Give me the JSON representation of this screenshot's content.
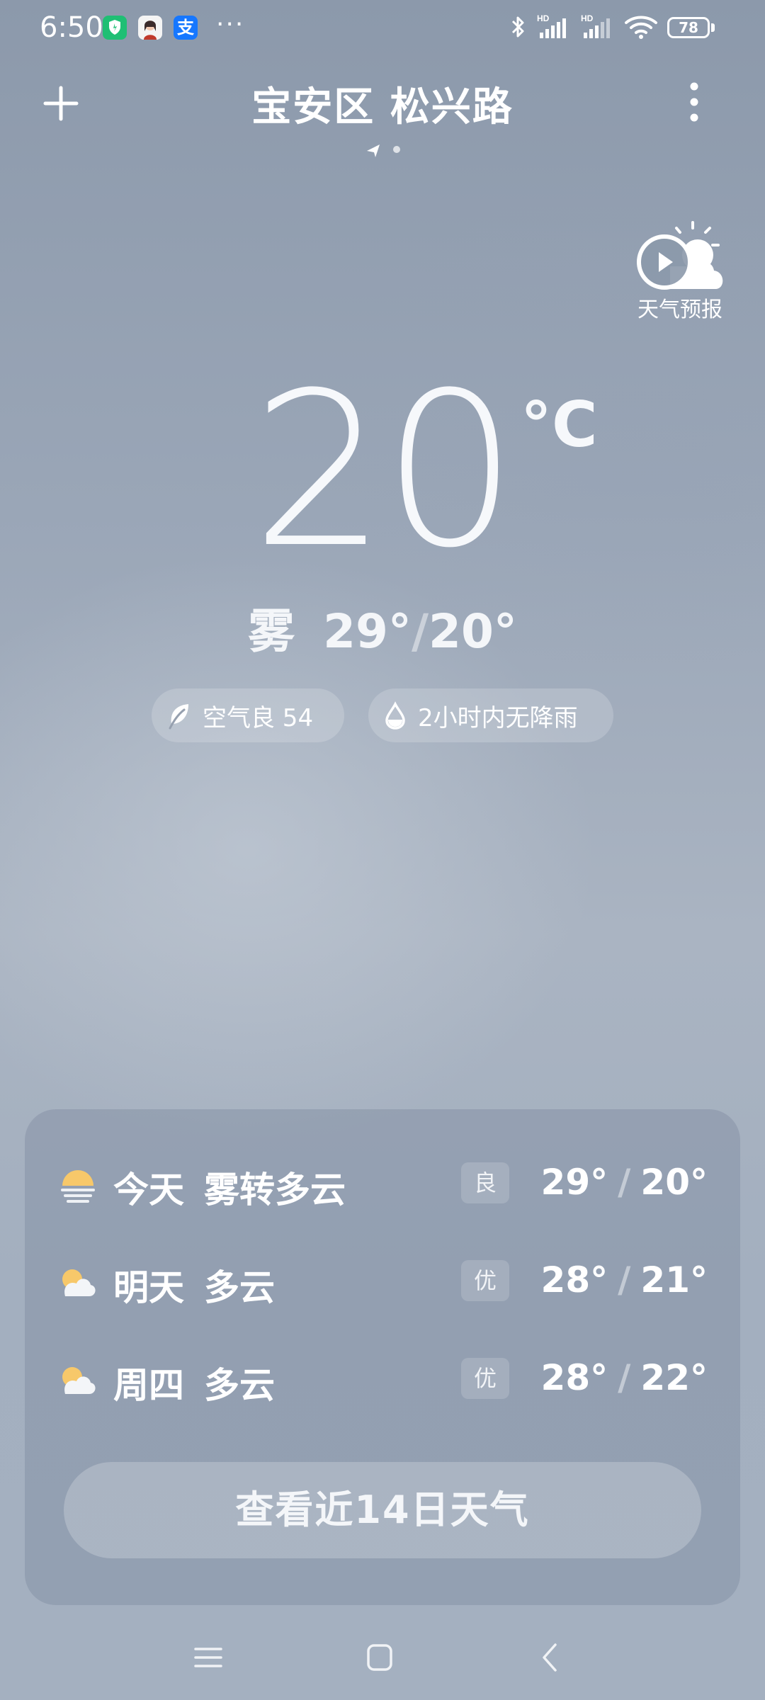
{
  "status_bar": {
    "time": "6:50",
    "battery": "78",
    "alipay_glyph": "支",
    "more_dots": "···",
    "icons": [
      "security-shield-icon",
      "avatar-icon",
      "alipay-icon",
      "bluetooth-icon",
      "signal-hd-icon",
      "signal-hd-icon",
      "wifi-icon",
      "battery-icon"
    ]
  },
  "header": {
    "location_title": "宝安区 松兴路",
    "add_icon": "plus-icon",
    "menu_icon": "more-vertical-icon",
    "page_indicator": [
      "location-arrow-icon",
      "page-dot"
    ]
  },
  "forecast_video": {
    "label": "天气预报",
    "icon": "play-cloud-sun-icon"
  },
  "current": {
    "temperature": "20",
    "unit": "°C",
    "condition": "雾",
    "high": "29°",
    "separator": "/",
    "low": "20°"
  },
  "chips": {
    "air": {
      "icon": "leaf-icon",
      "text": "空气良 54"
    },
    "rain": {
      "icon": "drop-icon",
      "text": "2小时内无降雨"
    }
  },
  "forecast": {
    "days": [
      {
        "day": "今天",
        "condition": "雾转多云",
        "aqi": "良",
        "high": "29°",
        "low": "20°",
        "icon": "fog-sun-icon"
      },
      {
        "day": "明天",
        "condition": "多云",
        "aqi": "优",
        "high": "28°",
        "low": "21°",
        "icon": "partly-cloudy-icon"
      },
      {
        "day": "周四",
        "condition": "多云",
        "aqi": "优",
        "high": "28°",
        "low": "22°",
        "icon": "partly-cloudy-icon"
      }
    ],
    "slash": "/",
    "cta_label": "查看近14日天气"
  },
  "colors": {
    "background_top": "#8c99ab",
    "background_mid": "#aab4c2",
    "card": "#7f8ca0",
    "sun": "#f7c86a"
  }
}
